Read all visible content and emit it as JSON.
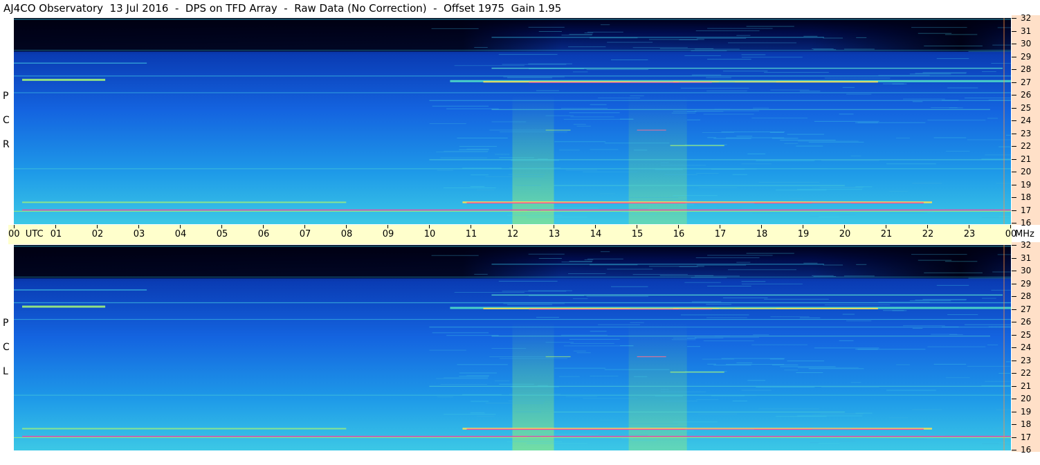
{
  "header": {
    "title": "AJ4CO Observatory  13 Jul 2016  -  DPS on TFD Array  -  Raw Data (No Correction)  -  Offset 1975  Gain 1.95"
  },
  "panels": [
    {
      "polarization": [
        "P",
        "C",
        "R"
      ]
    },
    {
      "polarization": [
        "P",
        "C",
        "L"
      ]
    }
  ],
  "time_axis": {
    "labels": [
      "00  UTC",
      "01",
      "02",
      "03",
      "04",
      "05",
      "06",
      "07",
      "08",
      "09",
      "10",
      "11",
      "12",
      "13",
      "14",
      "15",
      "16",
      "17",
      "18",
      "19",
      "20",
      "21",
      "22",
      "23",
      "00"
    ],
    "unit": "MHz"
  },
  "freq_axis": {
    "labels": [
      "32",
      "31",
      "30",
      "29",
      "28",
      "27",
      "26",
      "25",
      "24",
      "23",
      "22",
      "21",
      "20",
      "19",
      "18",
      "17",
      "16"
    ]
  },
  "chart_data": {
    "type": "heatmap",
    "title": "AJ4CO Observatory  13 Jul 2016  -  DPS on TFD Array  -  Raw Data (No Correction)  -  Offset 1975  Gain 1.95",
    "xlabel": "UTC",
    "ylabel": "MHz",
    "xlim": [
      0,
      24
    ],
    "ylim": [
      16,
      32
    ],
    "series": [
      {
        "name": "R C P"
      },
      {
        "name": "L C P"
      }
    ],
    "colors": {
      "low": "#00002a",
      "mid": "#1e64e6",
      "high": "#46d2e6",
      "peak": "#ff3cb4"
    }
  }
}
